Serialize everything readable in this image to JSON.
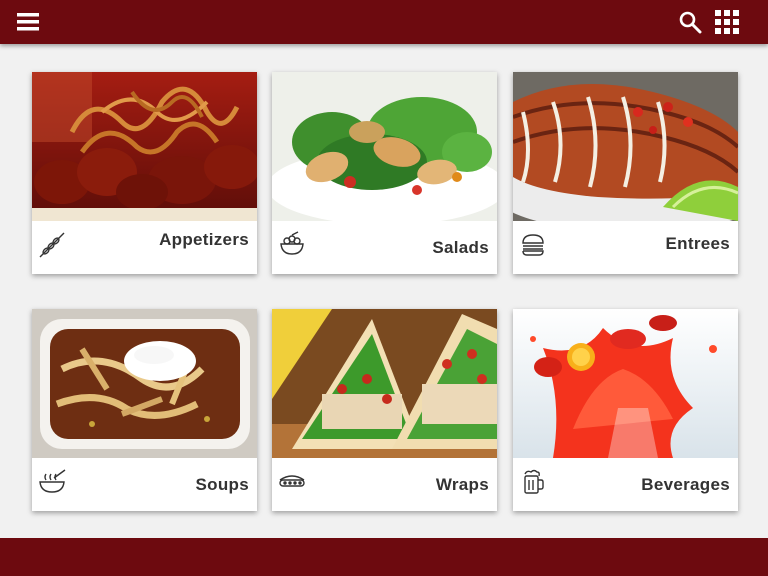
{
  "colors": {
    "brand": "#6d0a0f",
    "background": "#f1f1f1",
    "label": "#333333"
  },
  "header": {
    "menu_icon": "hamburger-menu-icon",
    "search_icon": "search-icon",
    "grid_icon": "grid-apps-icon"
  },
  "categories": [
    {
      "label": "Appetizers",
      "icon": "skewer-icon"
    },
    {
      "label": "Salads",
      "icon": "salad-bowl-icon"
    },
    {
      "label": "Entrees",
      "icon": "burger-icon"
    },
    {
      "label": "Soups",
      "icon": "soup-bowl-icon"
    },
    {
      "label": "Wraps",
      "icon": "wrap-icon"
    },
    {
      "label": "Beverages",
      "icon": "beer-mug-icon"
    }
  ]
}
